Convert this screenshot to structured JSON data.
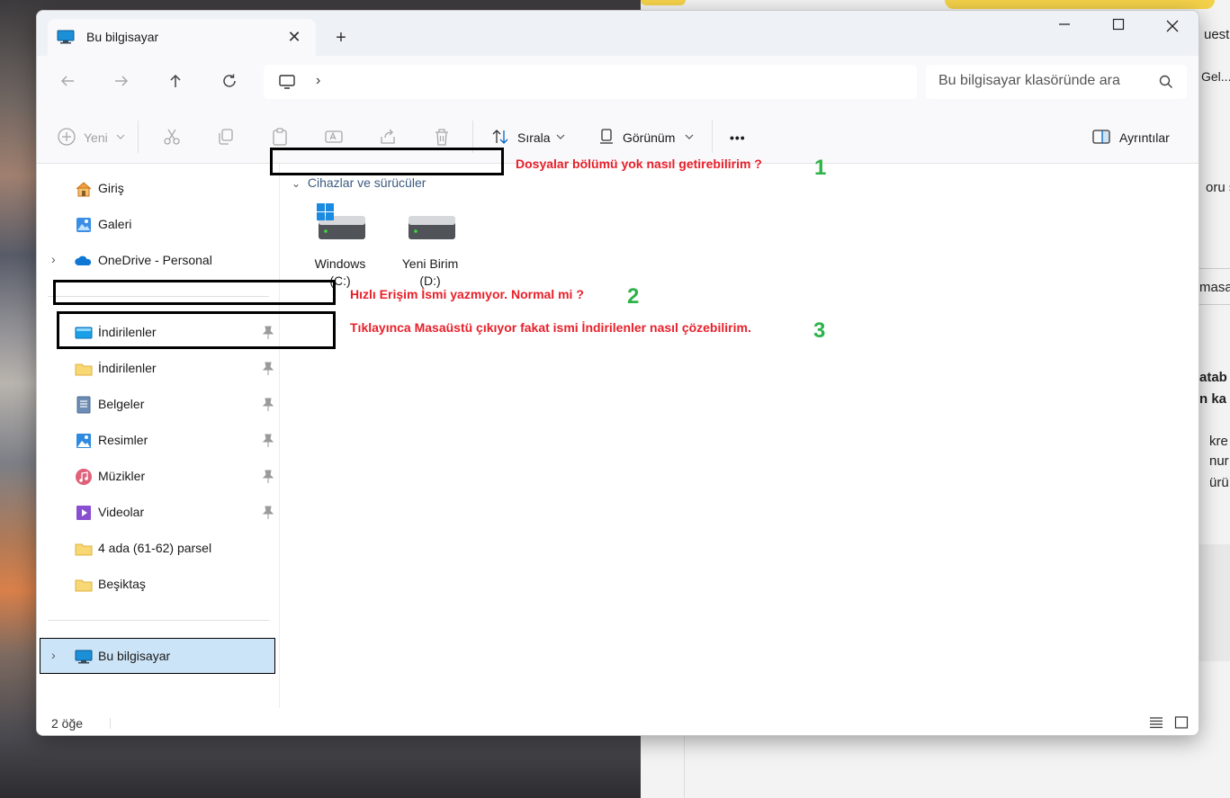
{
  "window": {
    "tab_title": "Bu bilgisayar",
    "new_tab_symbol": "+",
    "close_symbol": "✕"
  },
  "navigation": {
    "address_chevron": "›",
    "search_placeholder": "Bu bilgisayar klasöründe ara"
  },
  "toolbar": {
    "new_label": "Yeni",
    "sort_label": "Sırala",
    "view_label": "Görünüm",
    "more_label": "•••",
    "details_label": "Ayrıntılar"
  },
  "sidebar": {
    "items": [
      {
        "label": "Giriş",
        "icon": "home-icon"
      },
      {
        "label": "Galeri",
        "icon": "gallery-icon"
      },
      {
        "label": "OneDrive - Personal",
        "icon": "onedrive-icon"
      },
      {
        "label": "İndirilenler",
        "icon": "desktop-folder-icon",
        "pinned": true
      },
      {
        "label": "İndirilenler",
        "icon": "folder-icon",
        "pinned": true
      },
      {
        "label": "Belgeler",
        "icon": "documents-icon",
        "pinned": true
      },
      {
        "label": "Resimler",
        "icon": "pictures-icon",
        "pinned": true
      },
      {
        "label": "Müzikler",
        "icon": "music-icon",
        "pinned": true
      },
      {
        "label": "Videolar",
        "icon": "videos-icon",
        "pinned": true
      },
      {
        "label": "4 ada (61-62) parsel",
        "icon": "folder-icon"
      },
      {
        "label": "Beşiktaş",
        "icon": "folder-icon"
      },
      {
        "label": "Bu bilgisayar",
        "icon": "pc-icon",
        "selected": true
      }
    ]
  },
  "content": {
    "group_header": "Cihazlar ve sürücüler",
    "drives": [
      {
        "name": "Windows",
        "letter": "(C:)"
      },
      {
        "name": "Yeni Birim",
        "letter": "(D:)"
      }
    ]
  },
  "statusbar": {
    "item_count": "2 öğe"
  },
  "annotations": [
    {
      "text": "Dosyalar bölümü yok nasıl getirebilirim ?",
      "number": "1"
    },
    {
      "text": "Hızlı Erişim İsmi yazmıyor. Normal mi ?",
      "number": "2"
    },
    {
      "text": "Tıklayınca Masaüstü çıkıyor fakat ismi İndirilenler nasıl çözebilirim.",
      "number": "3"
    }
  ],
  "background_window": {
    "fragments": [
      "uestio",
      "Gel...",
      "oru s",
      "masa",
      "atab",
      "n ka",
      "kre",
      "nur",
      "ürü"
    ]
  },
  "colors": {
    "accent": "#0067c0",
    "selection": "#cce4f7",
    "annotation_red": "#e8202a",
    "annotation_green": "#2db34a"
  }
}
